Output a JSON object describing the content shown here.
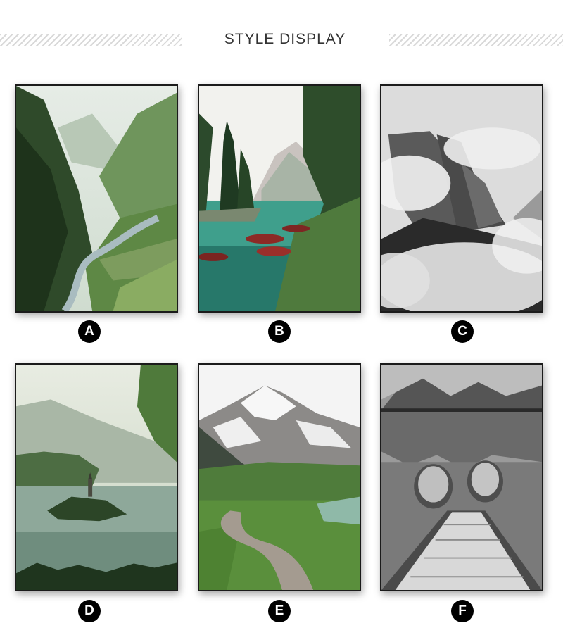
{
  "header": {
    "title": "STYLE DISPLAY"
  },
  "posters": [
    {
      "label": "A",
      "subject": "green mountain valley with river",
      "palette": "green"
    },
    {
      "label": "B",
      "subject": "turquoise lake with red rowboats and pine trees",
      "palette": "teal"
    },
    {
      "label": "C",
      "subject": "misty mountain cliffs in clouds",
      "palette": "monochrome"
    },
    {
      "label": "D",
      "subject": "misty lake with island church",
      "palette": "green"
    },
    {
      "label": "E",
      "subject": "snowy mountain with wooden boardwalk through grass",
      "palette": "green"
    },
    {
      "label": "F",
      "subject": "wooden dock with two rowboats on mountain lake",
      "palette": "monochrome"
    }
  ]
}
